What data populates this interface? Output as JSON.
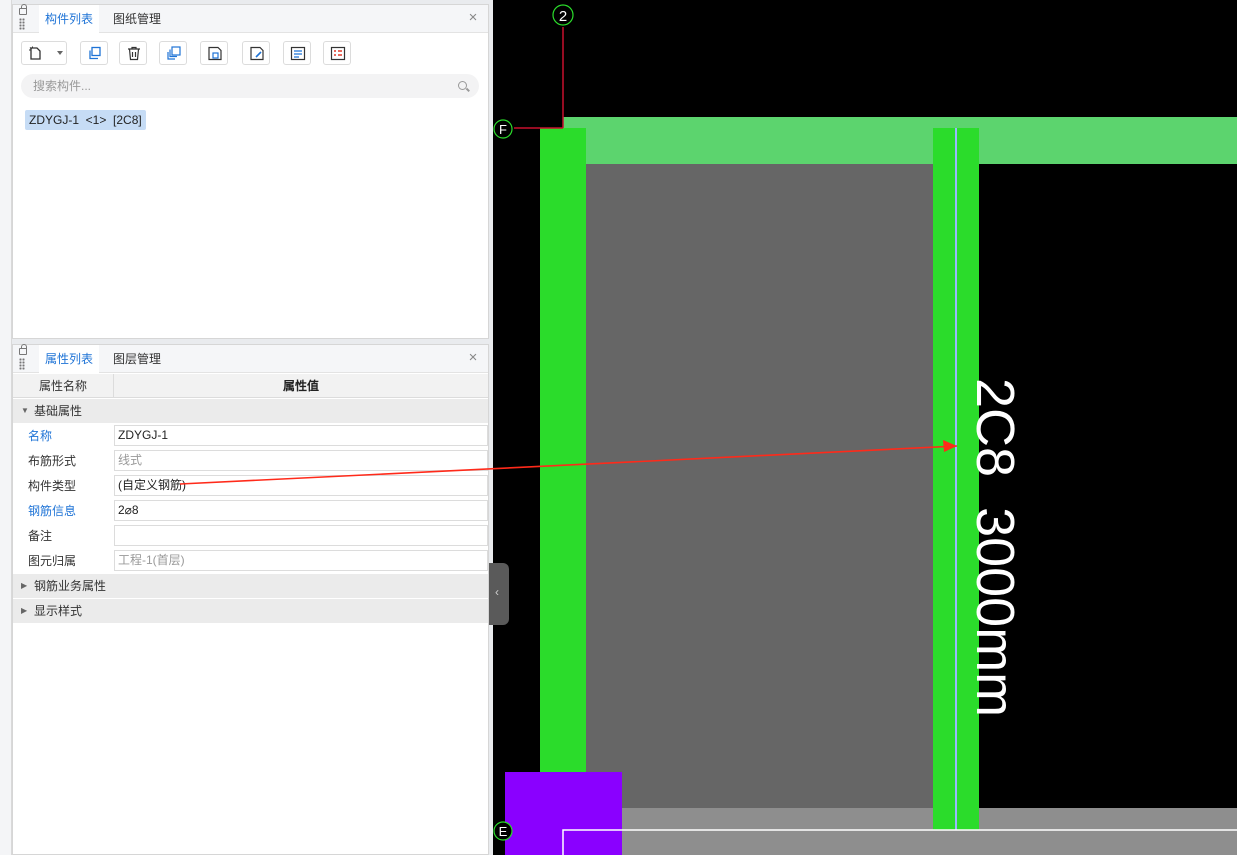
{
  "component_panel": {
    "tabs": [
      "构件列表",
      "图纸管理"
    ],
    "toolbar_icons": [
      "new-icon",
      "copy-icon",
      "delete-icon",
      "copy-layers-icon",
      "save-icon",
      "rename-icon",
      "properties-icon",
      "settings-icon"
    ],
    "search_placeholder": "搜索构件...",
    "items": [
      "ZDYGJ-1  <1>  [2C8]"
    ]
  },
  "property_panel": {
    "tabs": [
      "属性列表",
      "图层管理"
    ],
    "headers": {
      "name": "属性名称",
      "value": "属性值"
    },
    "group_basic": "基础属性",
    "rows": [
      {
        "name": "名称",
        "value": "ZDYGJ-1",
        "highlight": true,
        "readonly": false
      },
      {
        "name": "布筋形式",
        "value": "线式",
        "highlight": false,
        "readonly": true
      },
      {
        "name": "构件类型",
        "value": "(自定义钢筋)",
        "highlight": false,
        "readonly": false
      },
      {
        "name": "钢筋信息",
        "value": "2⌀8",
        "highlight": true,
        "readonly": false
      },
      {
        "name": "备注",
        "value": "",
        "highlight": false,
        "readonly": false
      },
      {
        "name": "图元归属",
        "value": "工程-1(首层)",
        "highlight": false,
        "readonly": true
      }
    ],
    "group_rebar": "钢筋业务属性",
    "group_display": "显示样式"
  },
  "canvas": {
    "axis_top": "2",
    "axis_left_top": "F",
    "axis_left_bottom": "E",
    "rebar_label": "2C8  3000mm",
    "colors": {
      "background": "#000000",
      "beam_green": "#5cd46e",
      "rebar_green": "#2bdc2b",
      "fill_gray": "#666666",
      "arrow_red": "#ff2a1a",
      "column_purple": "#8a00ff",
      "axis_red": "#c8102e",
      "rebar_line_blue": "#9ab8ff"
    }
  }
}
